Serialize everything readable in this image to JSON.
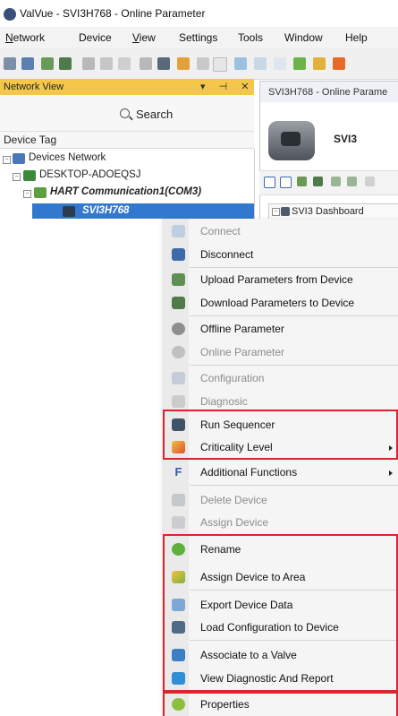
{
  "window": {
    "title": "ValVue - SVI3H768 - Online Parameter"
  },
  "menubar": {
    "items": [
      {
        "u": "N",
        "rest": "etwork"
      },
      {
        "u": "",
        "rest": "Device"
      },
      {
        "u": "V",
        "rest": "iew"
      },
      {
        "u": "",
        "rest": "Settings"
      },
      {
        "u": "",
        "rest": "Tools"
      },
      {
        "u": "",
        "rest": "Window"
      },
      {
        "u": "",
        "rest": "Help"
      }
    ]
  },
  "network_view": {
    "title": "Network View",
    "header_buttons": "▾ ⊣ ✕",
    "search_label": "Search",
    "column_header": "Device Tag",
    "tree": {
      "root": "Devices Network",
      "computer": "DESKTOP-ADOEQSJ",
      "channel": "HART Communication1(COM3)",
      "device": "SVI3H768"
    }
  },
  "document": {
    "tab_title": "SVI3H768 - Online Parame",
    "device_label": "SVI3",
    "dashboard_label": "SVI3 Dashboard"
  },
  "context_menu": {
    "items": [
      {
        "label": "Connect",
        "icon": "plug-icon"
      },
      {
        "label": "Disconnect",
        "icon": "unplug-icon"
      },
      {
        "label": "Upload Parameters from Device",
        "icon": "upload-icon"
      },
      {
        "label": "Download Parameters to Device",
        "icon": "download-icon"
      },
      {
        "label": "Offline Parameter",
        "icon": "offline-icon"
      },
      {
        "label": "Online Parameter",
        "icon": "online-icon"
      },
      {
        "label": "Configuration",
        "icon": "config-icon"
      },
      {
        "label": "Diagnosic",
        "icon": "diagnostic-icon"
      },
      {
        "label": "Run Sequencer",
        "icon": "sequencer-icon"
      },
      {
        "label": "Criticality Level",
        "icon": "criticality-icon"
      },
      {
        "label": "Additional Functions",
        "icon": "function-icon"
      },
      {
        "label": "Delete Device",
        "icon": "delete-icon"
      },
      {
        "label": "Assign Device",
        "icon": "assign-icon"
      },
      {
        "label": "Rename",
        "icon": "rename-icon"
      },
      {
        "label": "Assign Device to Area",
        "icon": "area-icon"
      },
      {
        "label": "Export Device Data",
        "icon": "export-icon"
      },
      {
        "label": "Load Configuration to Device",
        "icon": "load-config-icon"
      },
      {
        "label": "Associate to a Valve",
        "icon": "valve-icon"
      },
      {
        "label": "View Diagnostic And Report",
        "icon": "report-icon"
      },
      {
        "label": "Properties",
        "icon": "properties-icon"
      }
    ]
  },
  "colors": {
    "network_view_header": "#f4c64a",
    "selection": "#3378cf",
    "highlight_box": "#d8262c"
  }
}
